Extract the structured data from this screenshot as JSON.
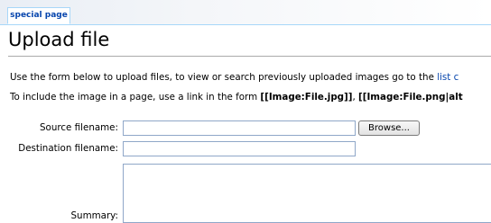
{
  "tab": {
    "label": "special page"
  },
  "page": {
    "title": "Upload file"
  },
  "intro": {
    "line1_text": "Use the form below to upload files, to view or search previously uploaded images go to the",
    "line1_link": "list c",
    "line2_prefix": "To include the image in a page, use a link in the form",
    "line2_example1": "[[Image:File.jpg]]",
    "line2_sep": ",",
    "line2_example2": "[[Image:File.png|alt"
  },
  "form": {
    "source_label": "Source filename:",
    "source_value": "",
    "browse_label": "Browse...",
    "destination_label": "Destination filename:",
    "destination_value": "",
    "summary_label": "Summary:",
    "summary_value": ""
  }
}
